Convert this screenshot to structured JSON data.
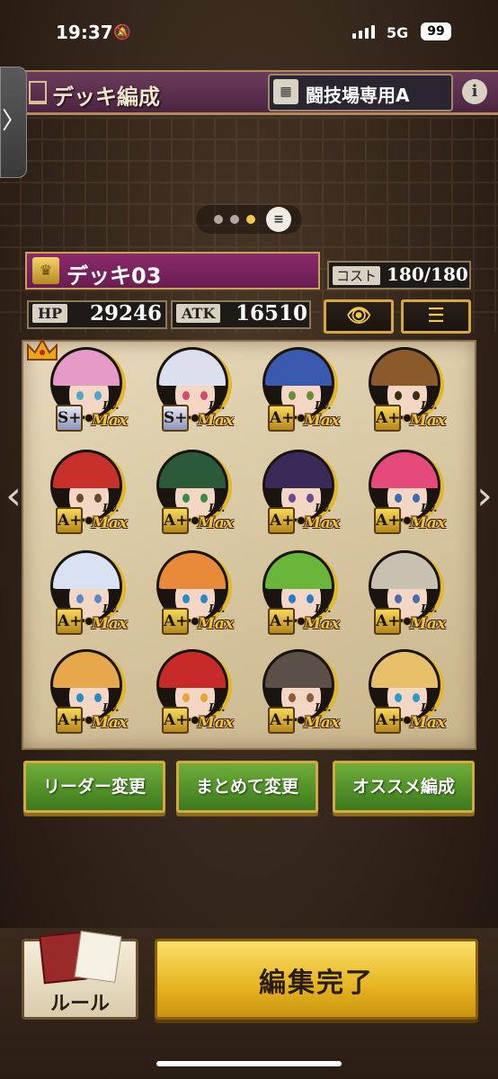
{
  "status": {
    "time": "19:37",
    "network": "5G",
    "battery": "99"
  },
  "header": {
    "title": "デッキ編成",
    "deck_type": "闘技場専用A",
    "info_glyph": "i",
    "side_tab_glyph": "〉"
  },
  "deck": {
    "name": "デッキ03",
    "cost_label": "コスト",
    "cost_value": "180/180",
    "hp_label": "HP",
    "hp_value": "29246",
    "atk_label": "ATK",
    "atk_value": "16510",
    "page_index": 3,
    "page_count": 3
  },
  "slot_text": {
    "lv": "Lv.",
    "max": "Max"
  },
  "units": [
    {
      "rank": "S+",
      "hair": "#e69ac8",
      "eye": "#4fa6c8",
      "leader": true
    },
    {
      "rank": "S+",
      "hair": "#dcdfee",
      "eye": "#d04a6a"
    },
    {
      "rank": "A+",
      "hair": "#3a5ab0",
      "eye": "#6a8a3a"
    },
    {
      "rank": "A+",
      "hair": "#8a5a2a",
      "eye": "#3a2a1a"
    },
    {
      "rank": "A+",
      "hair": "#c8302a",
      "eye": "#6a4a2a"
    },
    {
      "rank": "A+",
      "hair": "#2a5a3a",
      "eye": "#3a8a4a"
    },
    {
      "rank": "A+",
      "hair": "#3a2a5a",
      "eye": "#6a4a8a"
    },
    {
      "rank": "A+",
      "hair": "#e64a7a",
      "eye": "#3a6ab0"
    },
    {
      "rank": "A+",
      "hair": "#d8e2f2",
      "eye": "#5a8ac8"
    },
    {
      "rank": "A+",
      "hair": "#e88a3a",
      "eye": "#2a8ac8"
    },
    {
      "rank": "A+",
      "hair": "#6ab63a",
      "eye": "#2a7ac8"
    },
    {
      "rank": "A+",
      "hair": "#c8c0b0",
      "eye": "#4a6ab0"
    },
    {
      "rank": "A+",
      "hair": "#e6a84a",
      "eye": "#2a8ac8"
    },
    {
      "rank": "A+",
      "hair": "#c82a2a",
      "eye": "#e8a43a"
    },
    {
      "rank": "A+",
      "hair": "#5a5048",
      "eye": "#8a5a3a"
    },
    {
      "rank": "A+",
      "hair": "#e8c06a",
      "eye": "#2a9ac8"
    }
  ],
  "actions": {
    "leader": "リーダー変更",
    "bulk": "まとめて変更",
    "recommend": "オススメ編成"
  },
  "footer": {
    "rules": "ルール",
    "done": "編集完了"
  },
  "toolbar": {
    "view_glyph": "👁",
    "menu_glyph": "☰",
    "list_glyph": "≡"
  },
  "nav": {
    "prev_glyph": "‹",
    "next_glyph": "›"
  },
  "colors": {
    "accent_gold": "#d6a940",
    "header_purple": "#6a3b5a",
    "deck_magenta": "#8a2a6a",
    "action_green": "#4c8a28",
    "done_yellow": "#e6b421"
  }
}
